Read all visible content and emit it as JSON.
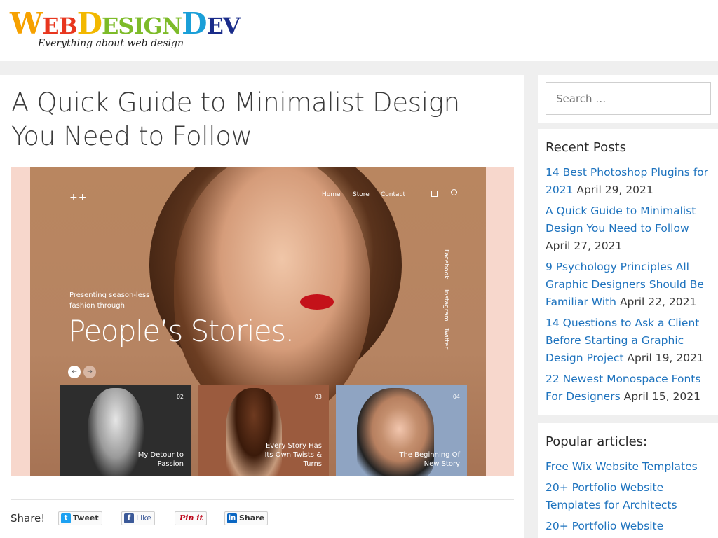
{
  "header": {
    "logo_w": "W",
    "logo_eb": "EB",
    "logo_d1": "D",
    "logo_esign": "ESIGN",
    "logo_d2": "D",
    "logo_ev": "EV",
    "tagline": "Everything about web design",
    "colors": {
      "w": "#f6a100",
      "eb": "#e8361e",
      "d1": "#f2b800",
      "esign": "#7dbb29",
      "d2": "#1a9fd8",
      "ev": "#1a2c8a"
    }
  },
  "article": {
    "title": "A Quick Guide to Minimalist Design You Need to Follow",
    "hero": {
      "plus": "++",
      "nav": [
        "Home",
        "Store",
        "Contact"
      ],
      "social": [
        "Facebook",
        "Instagram",
        "Twitter"
      ],
      "subtitle_line1": "Presenting season-less",
      "subtitle_line2": "fashion through",
      "headline": "People’s Stories.",
      "prev": "←",
      "next": "→",
      "cards": [
        {
          "num": "02",
          "caption": "My Detour to Passion"
        },
        {
          "num": "03",
          "caption": "Every Story Has Its Own Twists & Turns"
        },
        {
          "num": "04",
          "caption": "The Beginning Of New Story"
        }
      ]
    },
    "share": {
      "label": "Share!",
      "tweet": "Tweet",
      "like": "Like",
      "pin": "Pin it",
      "linkedin": "Share"
    }
  },
  "sidebar": {
    "search_placeholder": "Search …",
    "recent_heading": "Recent Posts",
    "recent_posts": [
      {
        "title": "14 Best Photoshop Plugins for 2021",
        "date": "April 29, 2021"
      },
      {
        "title": "A Quick Guide to Minimalist Design You Need to Follow",
        "date": "April 27, 2021"
      },
      {
        "title": "9 Psychology Principles All Graphic Designers Should Be Familiar With",
        "date": "April 22, 2021"
      },
      {
        "title": "14 Questions to Ask a Client Before Starting a Graphic Design Project",
        "date": "April 19, 2021"
      },
      {
        "title": "22 Newest Monospace Fonts For Designers",
        "date": "April 15, 2021"
      }
    ],
    "popular_heading": "Popular articles:",
    "popular": [
      "Free Wix Website Templates",
      "20+ Portfolio Website Templates for Architects",
      "20+ Portfolio Website"
    ]
  },
  "colors": {
    "link": "#1e73be",
    "text": "#3a3a3a",
    "page_bg": "#efefef"
  },
  "icons": {
    "search": "search-icon",
    "grid": "grid-icon",
    "twitter": "twitter-bird-icon",
    "facebook": "facebook-f-icon",
    "linkedin": "linkedin-in-icon"
  }
}
